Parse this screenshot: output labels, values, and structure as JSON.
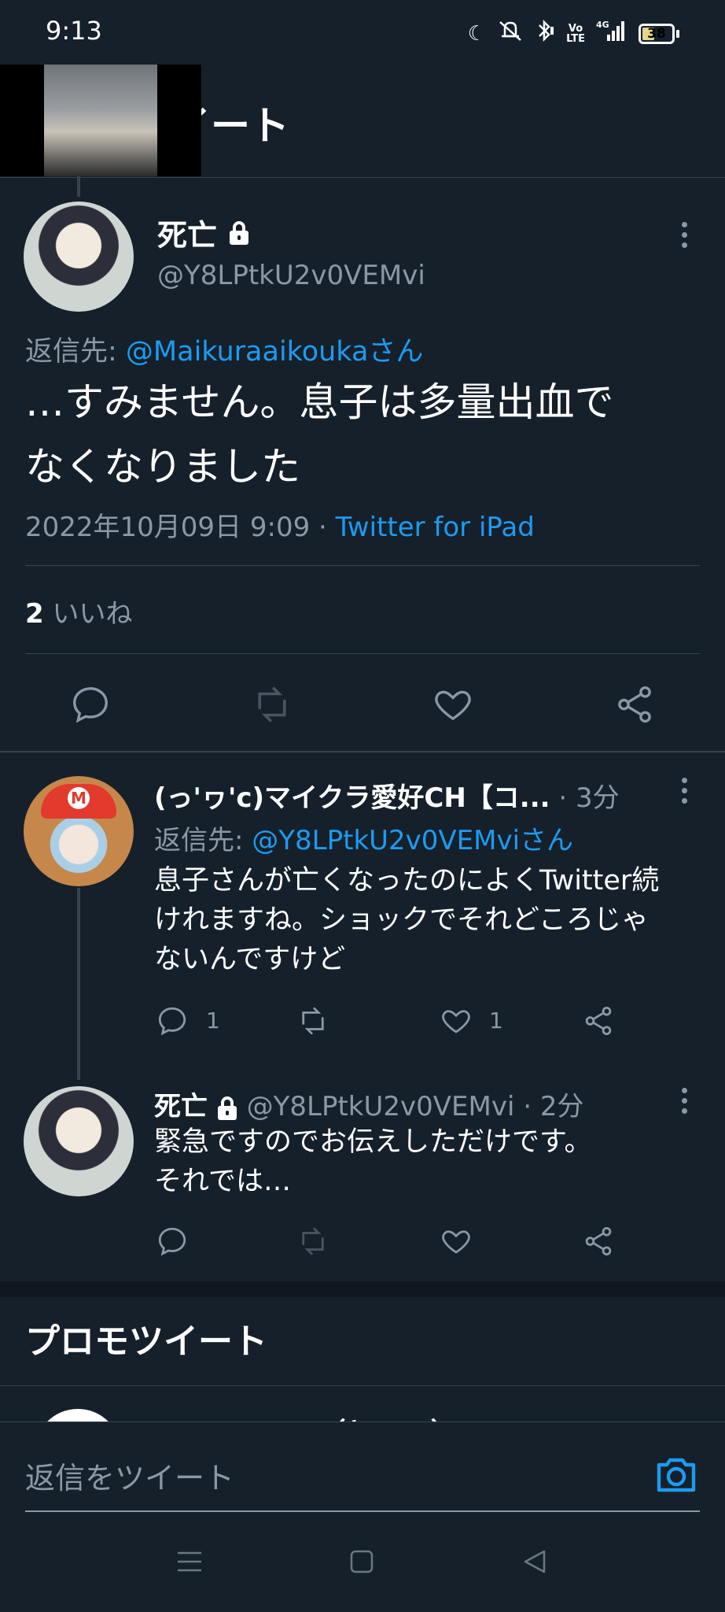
{
  "status_bar": {
    "time": "9:13",
    "network_label": "4G",
    "volte_label": "VoLTE",
    "battery": "38"
  },
  "header": {
    "title": "イート"
  },
  "main_tweet": {
    "name": "死亡",
    "handle": "@Y8LPtkU2v0VEMvi",
    "reply_to_prefix": "返信先: ",
    "reply_to_user": "@Maikuraaikoukaさん",
    "text_line1": "…すみません。息子は多量出血で",
    "text_line2": "なくなりました",
    "date": "2022年10月09日 9:09 · ",
    "source": "Twitter for iPad",
    "likes_count": "2",
    "likes_label": " いいね"
  },
  "replies": [
    {
      "name": "(っ'ヮ'c)マイクラ愛好CH【コ...",
      "meta": " · 3分",
      "reply_to_prefix": "返信先: ",
      "reply_to_user": "@Y8LPtkU2v0VEMviさん",
      "text_line1": "息子さんが亡くなったのによくTwitter続",
      "text_line2": "けれますね。ショックでそれどころじゃ",
      "text_line3": "ないんですけど",
      "reply_count": "1",
      "like_count": "1"
    },
    {
      "name": "死亡",
      "meta": " @Y8LPtkU2v0VEMvi · 2分",
      "text_line1": "緊急ですのでお伝えしただけです。",
      "text_line2": "それでは…"
    }
  ],
  "promoted": {
    "title": "プロモツイート",
    "peek_name": "Y-lo  JAPAN（ヤフー）"
  },
  "composer": {
    "placeholder": "返信をツイート"
  },
  "colors": {
    "background": "#15202b",
    "accent": "#1d9bf0",
    "muted": "#8b98a5",
    "divider": "#38444d"
  }
}
